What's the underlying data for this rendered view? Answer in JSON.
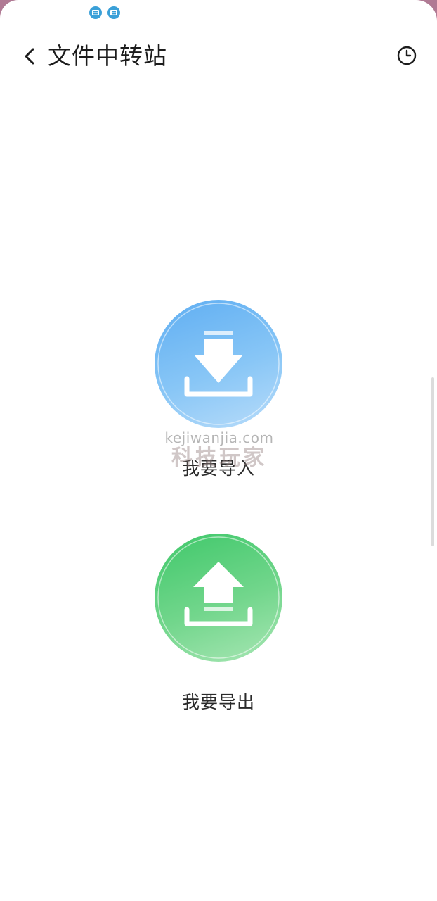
{
  "status_bar": {
    "icons": [
      "notification-app-icon",
      "notification-app-icon"
    ]
  },
  "header": {
    "back_icon": "chevron-left-icon",
    "title": "文件中转站",
    "history_icon": "clock-icon"
  },
  "actions": {
    "import": {
      "label": "我要导入",
      "icon": "download-tray-icon",
      "color": "#6db8f4"
    },
    "export": {
      "label": "我要导出",
      "icon": "upload-tray-icon",
      "color": "#4fcc76"
    }
  },
  "watermark": {
    "url": "kejiwanjia.com",
    "text": "科技玩家"
  }
}
